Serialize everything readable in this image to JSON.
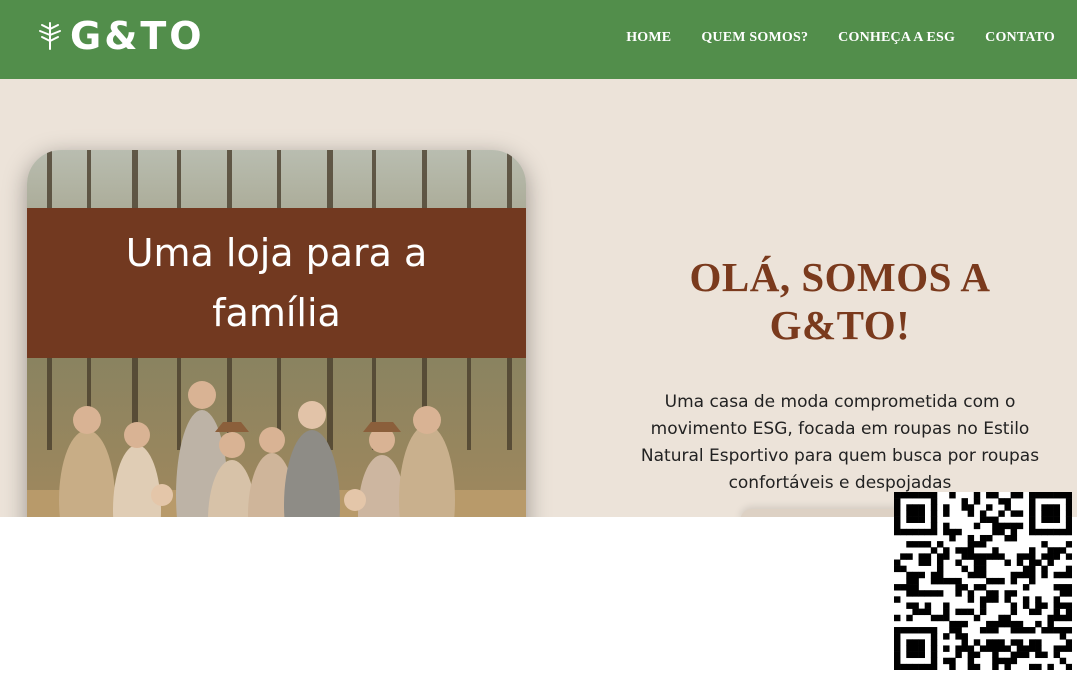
{
  "brand": {
    "name": "G&TO",
    "icon": "leaf-sprig-icon"
  },
  "nav": {
    "items": [
      "HOME",
      "QUEM SOMOS?",
      "CONHEÇA A ESG",
      "CONTATO"
    ]
  },
  "hero": {
    "banner_text": "Uma loja para a família",
    "headline": "OLÁ, SOMOS A G&TO!",
    "description": "Uma casa de moda comprometida com o movimento ESG, focada em roupas no Estilo Natural Esportivo para quem busca por roupas confortáveis e despojadas"
  },
  "colors": {
    "header": "#528e4b",
    "hero_bg": "#ece3d9",
    "banner": "#723920",
    "headline": "#7a3a1d"
  },
  "qr": {
    "icon": "qr-code-icon"
  }
}
